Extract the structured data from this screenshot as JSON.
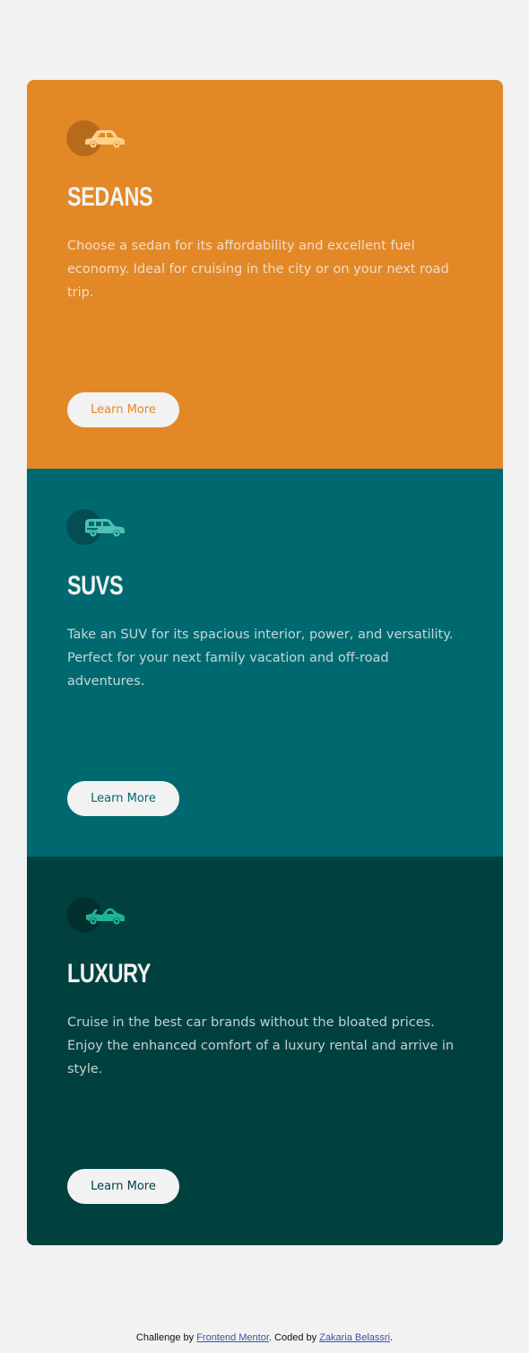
{
  "colors": {
    "page_background": "#f2f2f2",
    "sedans": "#e38826",
    "suvs": "#006970",
    "luxury": "#004140",
    "button_background": "#f2f2f2",
    "sedans_icon": "#ffd18a",
    "suvs_icon": "#4fc1b3",
    "luxury_icon": "#1fb49a"
  },
  "cards": [
    {
      "id": "sedans",
      "icon": "sedan-car-icon",
      "title": "Sedans",
      "text": "Choose a sedan for its affordability and excellent fuel economy. Ideal for cruising in the city or on your next road trip.",
      "button_label": "Learn More"
    },
    {
      "id": "suvs",
      "icon": "suv-car-icon",
      "title": "SUVs",
      "text": "Take an SUV for its spacious interior, power, and versatility. Perfect for your next family vacation and off-road adventures.",
      "button_label": "Learn More"
    },
    {
      "id": "luxury",
      "icon": "luxury-car-icon",
      "title": "Luxury",
      "text": "Cruise in the best car brands without the bloated prices. Enjoy the enhanced comfort of a luxury rental and arrive in style.",
      "button_label": "Learn More"
    }
  ],
  "footer": {
    "prefix": "Challenge by ",
    "challenge_link": "Frontend Mentor",
    "middle": ". Coded by ",
    "author_link": "Zakaria Belassri",
    "suffix": "."
  }
}
